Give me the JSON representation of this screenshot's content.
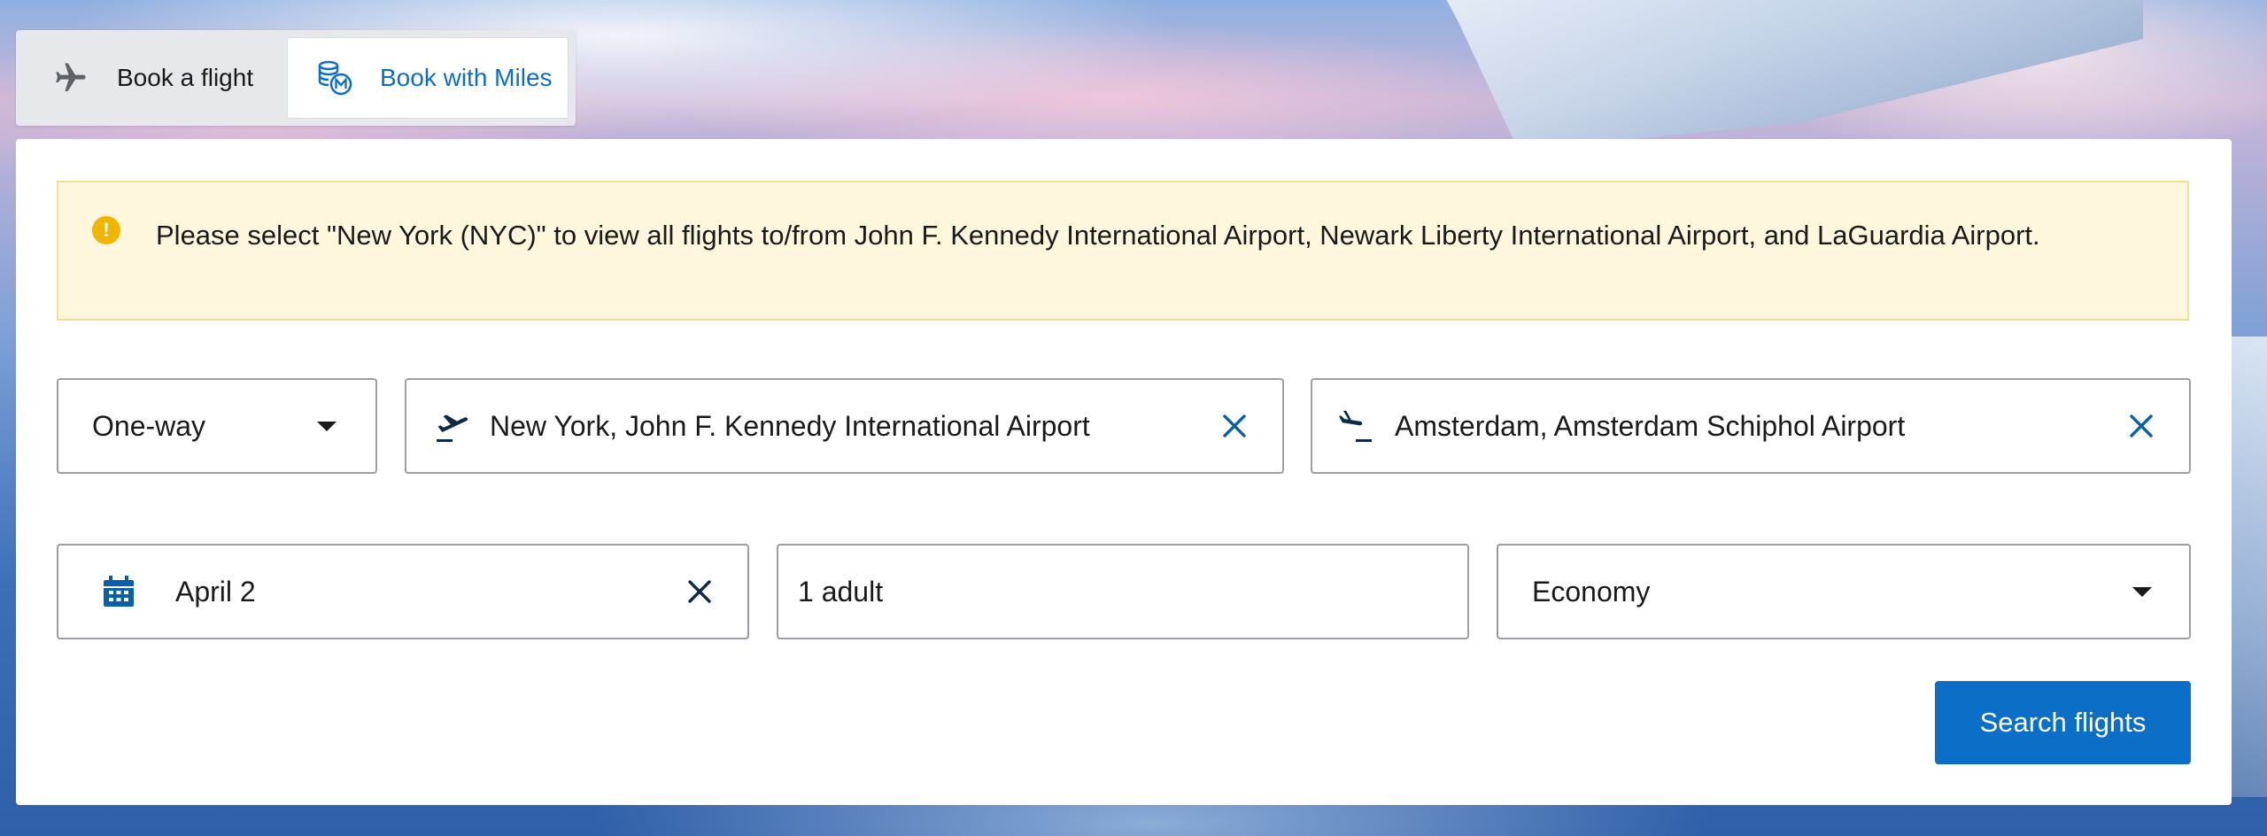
{
  "tabs": [
    {
      "label": "Book a flight",
      "icon": "airplane-icon"
    },
    {
      "label": "Book with Miles",
      "icon": "miles-coins-icon",
      "active": true
    }
  ],
  "alert": {
    "icon": "warning-icon",
    "text": "Please select \"New York (NYC)\" to view all flights to/from John F. Kennedy International Airport, Newark Liberty International Airport, and LaGuardia Airport."
  },
  "form": {
    "trip_type": "One-way",
    "from": "New York, John F. Kennedy International Airport",
    "to": "Amsterdam, Amsterdam Schiphol Airport",
    "date": "April 2",
    "passengers": "1 adult",
    "cabin": "Economy"
  },
  "actions": {
    "search_label": "Search flights"
  },
  "colors": {
    "primary": "#0b6fc8",
    "alert_bg": "#fff7dd",
    "alert_border": "#f2df93",
    "warning": "#f0b500",
    "icon_dark": "#0b2a4a"
  }
}
